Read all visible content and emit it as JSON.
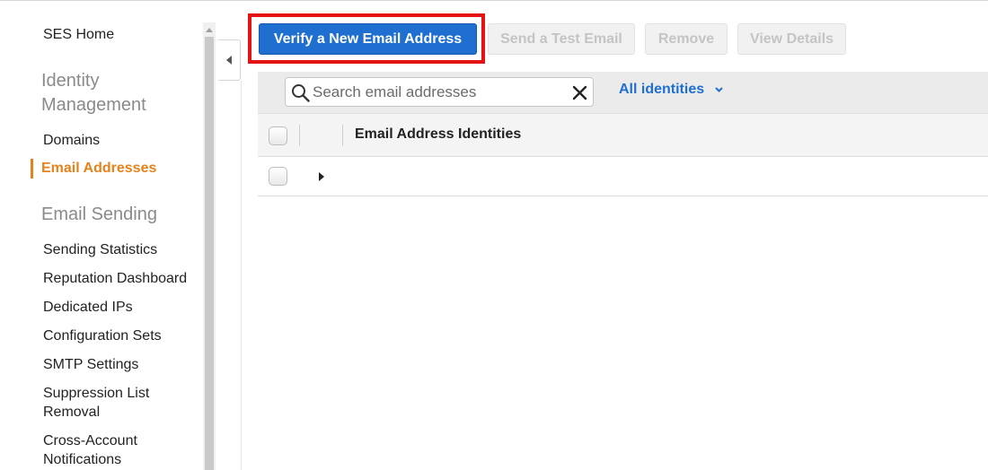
{
  "sidebar": {
    "home": "SES Home",
    "identity_heading": [
      "Identity",
      "Management"
    ],
    "identity_items": [
      "Domains",
      "Email Addresses"
    ],
    "sending_heading": "Email Sending",
    "sending_items": [
      "Sending Statistics",
      "Reputation Dashboard",
      "Dedicated IPs",
      "Configuration Sets",
      "SMTP Settings",
      [
        "Suppression List",
        "Removal"
      ],
      [
        "Cross-Account",
        "Notifications"
      ]
    ],
    "active_item": "Email Addresses"
  },
  "toolbar": {
    "verify_label": "Verify a New Email Address",
    "send_test_label": "Send a Test Email",
    "remove_label": "Remove",
    "view_details_label": "View Details"
  },
  "filter": {
    "search_placeholder": "Search email addresses",
    "identities_label": "All identities"
  },
  "table": {
    "column_header": "Email Address Identities"
  },
  "colors": {
    "accent": "#1f6fd1",
    "active": "#e7821b",
    "highlight": "#e51414"
  },
  "icons": [
    "search-icon",
    "close-icon",
    "chevron-down-icon",
    "caret-left-icon",
    "caret-right-icon",
    "scroll-up-icon"
  ]
}
